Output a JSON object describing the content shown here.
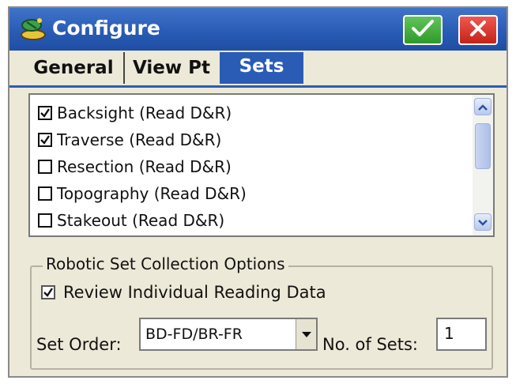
{
  "window": {
    "title": "Configure",
    "app_icon": "satellite-dish-icon",
    "ok_icon": "check-icon",
    "close_icon": "close-icon"
  },
  "tabs": [
    {
      "label": "General",
      "active": false
    },
    {
      "label": "View Pt",
      "active": false
    },
    {
      "label": "Sets",
      "active": true
    }
  ],
  "list": {
    "items": [
      {
        "label": "Backsight (Read D&R)",
        "checked": true
      },
      {
        "label": "Traverse (Read D&R)",
        "checked": true
      },
      {
        "label": "Resection (Read D&R)",
        "checked": false
      },
      {
        "label": "Topography (Read D&R)",
        "checked": false
      },
      {
        "label": "Stakeout (Read D&R)",
        "checked": false
      }
    ],
    "scroll_up_icon": "chevron-up-icon",
    "scroll_down_icon": "chevron-down-icon"
  },
  "robotic": {
    "group_title": "Robotic Set Collection Options",
    "review_label": "Review Individual Reading Data",
    "review_checked": true,
    "set_order_label": "Set Order:",
    "set_order_value": "BD-FD/BR-FR",
    "sets_label": "No. of Sets:",
    "sets_value": "1"
  },
  "colors": {
    "titlebar": "#2a5cb6",
    "dialog_bg": "#ece9d8",
    "ok": "#3fae38",
    "close": "#d9352a"
  }
}
